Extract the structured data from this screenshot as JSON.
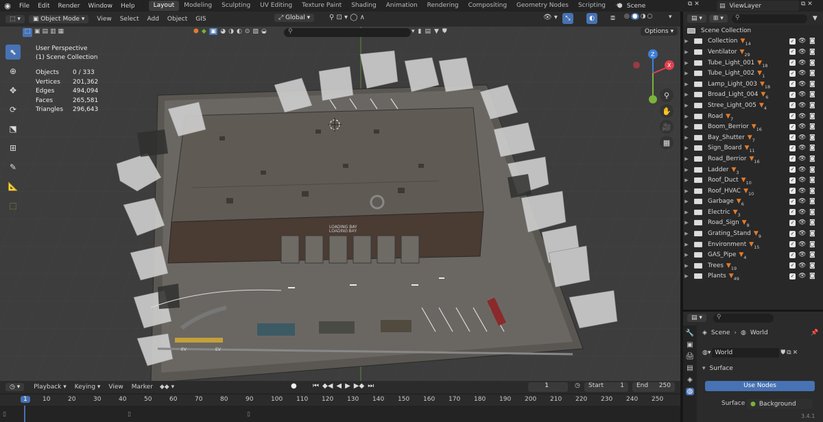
{
  "top_menu": [
    "File",
    "Edit",
    "Render",
    "Window",
    "Help"
  ],
  "workspace_tabs": [
    "Layout",
    "Modeling",
    "Sculpting",
    "UV Editing",
    "Texture Paint",
    "Shading",
    "Animation",
    "Rendering",
    "Compositing",
    "Geometry Nodes",
    "Scripting"
  ],
  "add_tab": "+",
  "scene_name": "Scene",
  "view_layer": "ViewLayer",
  "viewport_header": {
    "mode": "Object Mode",
    "menus": [
      "View",
      "Select",
      "Add",
      "Object",
      "GIS"
    ],
    "orientation": "Global",
    "options": "Options"
  },
  "overlay": {
    "perspective": "User Perspective",
    "collection": "(1) Scene Collection"
  },
  "stats": [
    {
      "label": "Objects",
      "value": "0 / 333"
    },
    {
      "label": "Vertices",
      "value": "201,362"
    },
    {
      "label": "Edges",
      "value": "494,094"
    },
    {
      "label": "Faces",
      "value": "265,581"
    },
    {
      "label": "Triangles",
      "value": "296,643"
    }
  ],
  "gizmo": {
    "x": "X",
    "y": "Y",
    "z": "Z"
  },
  "scene_text": {
    "bay_sign": "LOADING BAY",
    "ev": "EV"
  },
  "timeline": {
    "menus": [
      "Playback",
      "Keying",
      "View",
      "Marker"
    ],
    "current_frame": "1",
    "start_label": "Start",
    "start": "1",
    "end_label": "End",
    "end": "250",
    "frame_ticks": [
      "1",
      "10",
      "20",
      "30",
      "40",
      "50",
      "60",
      "70",
      "80",
      "90",
      "100",
      "110",
      "120",
      "130",
      "140",
      "150",
      "160",
      "170",
      "180",
      "190",
      "200",
      "210",
      "220",
      "230",
      "240",
      "250"
    ]
  },
  "outliner": {
    "root": "Scene Collection",
    "items": [
      {
        "name": "Collection",
        "count": "14"
      },
      {
        "name": "Ventilator",
        "count": "29"
      },
      {
        "name": "Tube_Light_001",
        "count": "18"
      },
      {
        "name": "Tube_Light_002",
        "count": "1"
      },
      {
        "name": "Lamp_Light_003",
        "count": "18"
      },
      {
        "name": "Broad_Light_004",
        "count": "6"
      },
      {
        "name": "Stree_Light_005",
        "count": "4"
      },
      {
        "name": "Road",
        "count": "7"
      },
      {
        "name": "Boom_Berrior",
        "count": "16"
      },
      {
        "name": "Bay_Shutter",
        "count": "7"
      },
      {
        "name": "Sign_Board",
        "count": "11"
      },
      {
        "name": "Road_Berrior",
        "count": "16"
      },
      {
        "name": "Ladder",
        "count": "3"
      },
      {
        "name": "Roof_Duct",
        "count": "10"
      },
      {
        "name": "Roof_HVAC",
        "count": "10"
      },
      {
        "name": "Garbage",
        "count": "6"
      },
      {
        "name": "Electric",
        "count": "3"
      },
      {
        "name": "Road_Sign",
        "count": "8"
      },
      {
        "name": "Grating_Stand",
        "count": "9"
      },
      {
        "name": "Environment",
        "count": "15"
      },
      {
        "name": "GAS_Pipe",
        "count": "4"
      },
      {
        "name": "Trees",
        "count": "19"
      },
      {
        "name": "Plants",
        "count": "49"
      }
    ]
  },
  "properties": {
    "breadcrumb_scene": "Scene",
    "breadcrumb_world": "World",
    "world_name": "World",
    "section": "Surface",
    "use_nodes": "Use Nodes",
    "surface_label": "Surface",
    "surface_value": "Background"
  },
  "version": "3.4.1",
  "colors": {
    "accent": "#4772b3",
    "funnel": "#e07c2e",
    "axis_x": "#e04050",
    "axis_y": "#7ab33a",
    "axis_z": "#3d7fd9"
  }
}
